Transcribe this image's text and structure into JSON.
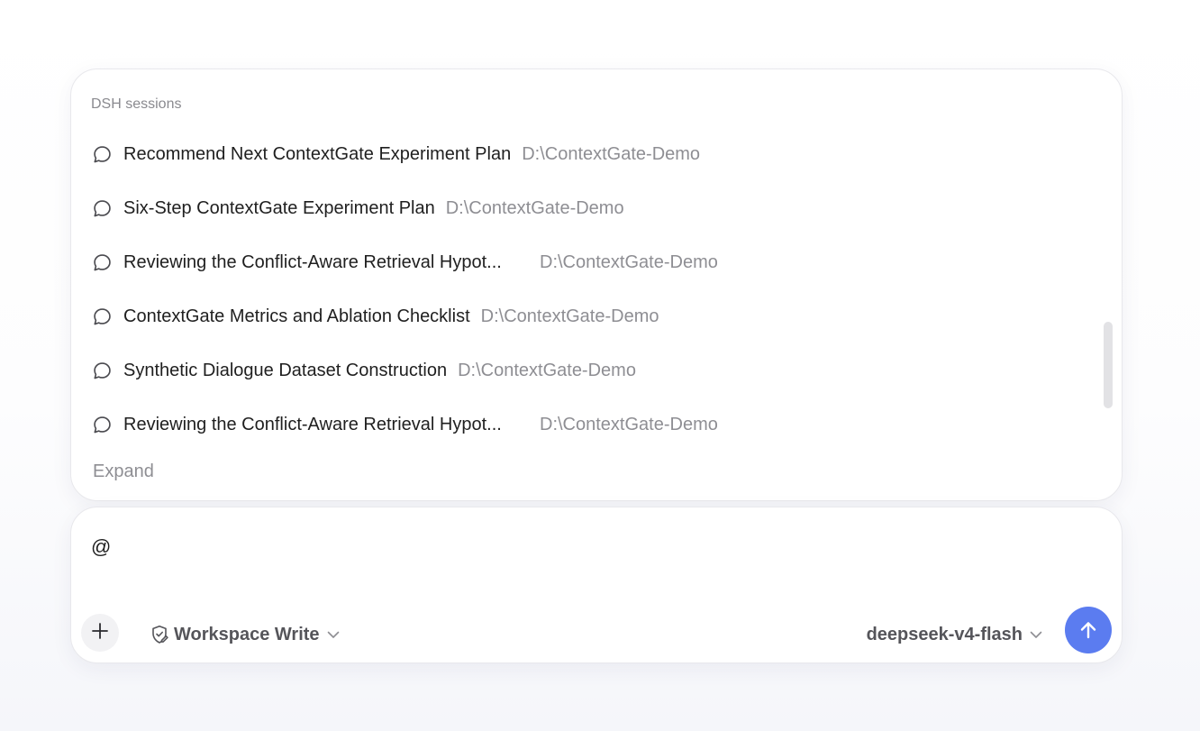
{
  "sessions_panel": {
    "title": "DSH sessions",
    "items": [
      {
        "title": "Recommend Next ContextGate Experiment Plan",
        "path": "D:\\ContextGate-Demo",
        "truncated": false
      },
      {
        "title": "Six-Step ContextGate Experiment Plan",
        "path": "D:\\ContextGate-Demo",
        "truncated": false
      },
      {
        "title": "Reviewing the Conflict-Aware Retrieval Hypot...",
        "path": "D:\\ContextGate-Demo",
        "truncated": true
      },
      {
        "title": "ContextGate Metrics and Ablation Checklist",
        "path": "D:\\ContextGate-Demo",
        "truncated": false
      },
      {
        "title": "Synthetic Dialogue Dataset Construction",
        "path": "D:\\ContextGate-Demo",
        "truncated": false
      },
      {
        "title": "Reviewing the Conflict-Aware Retrieval Hypot...",
        "path": "D:\\ContextGate-Demo",
        "truncated": true
      }
    ],
    "item_icon": "chat-bubble-icon",
    "expand_label": "Expand"
  },
  "composer": {
    "input_value": "@",
    "add_icon": "plus-icon",
    "mode_icon": "shield-edit-icon",
    "mode_label": "Workspace Write",
    "model_label": "deepseek-v4-flash",
    "send_icon": "arrow-up-icon"
  },
  "colors": {
    "accent": "#5b7cf0",
    "muted_text": "#8e8e93",
    "primary_text": "#1f1f1f"
  }
}
